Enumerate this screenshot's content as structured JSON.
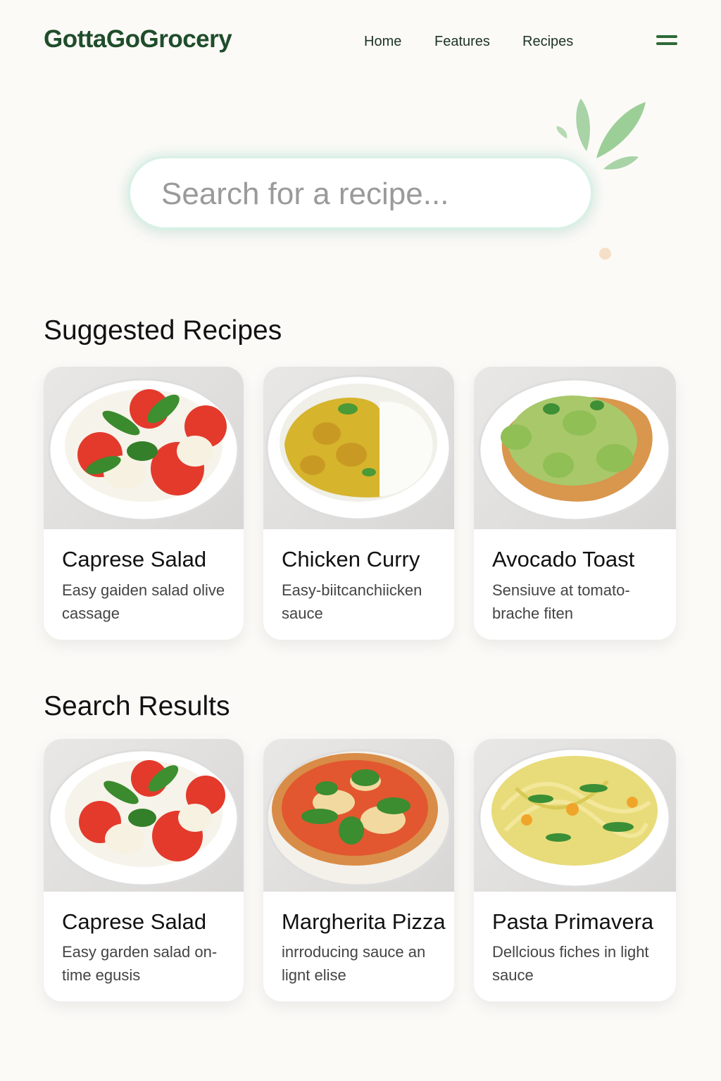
{
  "app": {
    "logo": "GottaGoGrocery"
  },
  "nav": {
    "items": [
      {
        "label": "Home"
      },
      {
        "label": "Features"
      },
      {
        "label": "Recipes"
      }
    ],
    "menu_icon": "hamburger-icon"
  },
  "search": {
    "placeholder": "Search for a recipe...",
    "value": ""
  },
  "suggested": {
    "title": "Suggested Recipes",
    "items": [
      {
        "name": "Caprese Salad",
        "desc": "Easy gaiden salad olive cassage",
        "image": "caprese-salad-photo"
      },
      {
        "name": "Chicken Curry",
        "desc": "Easy-biitcanchiicken sauce",
        "image": "chicken-curry-photo"
      },
      {
        "name": "Avocado Toast",
        "desc": "Sensiuve at tomato-brache fiten",
        "image": "avocado-toast-photo"
      }
    ]
  },
  "results": {
    "title": "Search Results",
    "items": [
      {
        "name": "Caprese Salad",
        "desc": "Easy garden salad on-time egusis",
        "image": "caprese-salad-photo"
      },
      {
        "name": "Margherita Pizza",
        "desc": "inrroducing sauce an lignt elise",
        "image": "margherita-pizza-photo"
      },
      {
        "name": "Pasta Primavera",
        "desc": "Dellcious fiches in light sauce",
        "image": "pasta-primavera-photo"
      }
    ]
  },
  "colors": {
    "brand": "#1f4d2b",
    "accent": "#2d6a38",
    "search_border": "#d8f1e6",
    "background": "#fcfaf7"
  }
}
